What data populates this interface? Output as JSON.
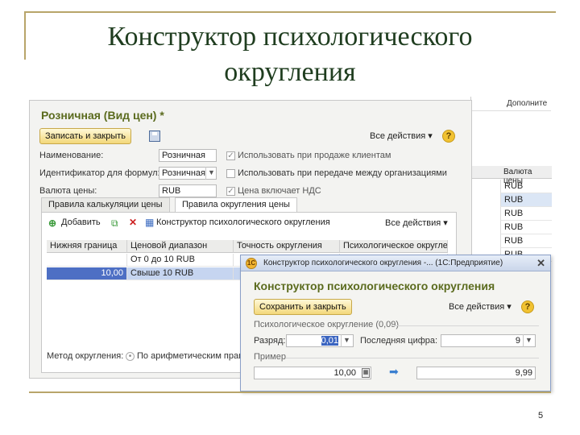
{
  "slide": {
    "title_line1": "Конструктор психологического",
    "title_line2": "округления",
    "page_number": "5"
  },
  "background_list": {
    "header_text": "Дополните",
    "column_header": "Валюта цены",
    "cells": [
      "RUB",
      "RUB",
      "RUB",
      "RUB",
      "RUB",
      "RUB"
    ]
  },
  "main_window": {
    "title": "Розничная (Вид цен) *",
    "toolbar": {
      "save_close_label": "Записать и закрыть",
      "all_actions_label": "Все действия ▾",
      "help_label": "?"
    },
    "fields": {
      "name_label": "Наименование:",
      "name_value": "Розничная",
      "use_sale_label": "Использовать при продаже клиентам",
      "formula_id_label": "Идентификатор для формул:",
      "formula_id_value": "Розничная",
      "use_transfer_label": "Использовать при передаче между организациями",
      "currency_label": "Валюта цены:",
      "currency_value": "RUB",
      "vat_label": "Цена включает НДС"
    },
    "tabs": [
      {
        "label": "Правила калькуляции цены"
      },
      {
        "label": "Правила округления цены"
      }
    ],
    "tab_toolbar": {
      "add_label": "Добавить",
      "constructor_label": "Конструктор психологического округления",
      "all_actions_label": "Все действия ▾"
    },
    "grid": {
      "headers": [
        "Нижняя граница",
        "Ценовой диапазон",
        "Точность округления",
        "Психологическое округле"
      ],
      "rows": [
        [
          "",
          "От 0 до 10 RUB",
          "",
          ""
        ],
        [
          "10,00",
          "Свыше 10 RUB",
          "",
          ""
        ]
      ]
    },
    "rounding_method_label": "Метод округления:",
    "rounding_method_value": "По арифметическим прави"
  },
  "dialog": {
    "titlebar": "Конструктор психологического округления -... (1С:Предприятие)",
    "app_icon": "1С",
    "close_label": "✕",
    "header": "Конструктор психологического округления",
    "save_close_label": "Сохранить и закрыть",
    "all_actions_label": "Все действия ▾",
    "help_label": "?",
    "group_rounding": "Психологическое округление (0,09)",
    "digit_label": "Разряд:",
    "digit_value": "0,01",
    "last_digit_label": "Последняя цифра:",
    "last_digit_value": "9",
    "group_example": "Пример",
    "example_input": "10,00",
    "example_result": "9,99"
  }
}
